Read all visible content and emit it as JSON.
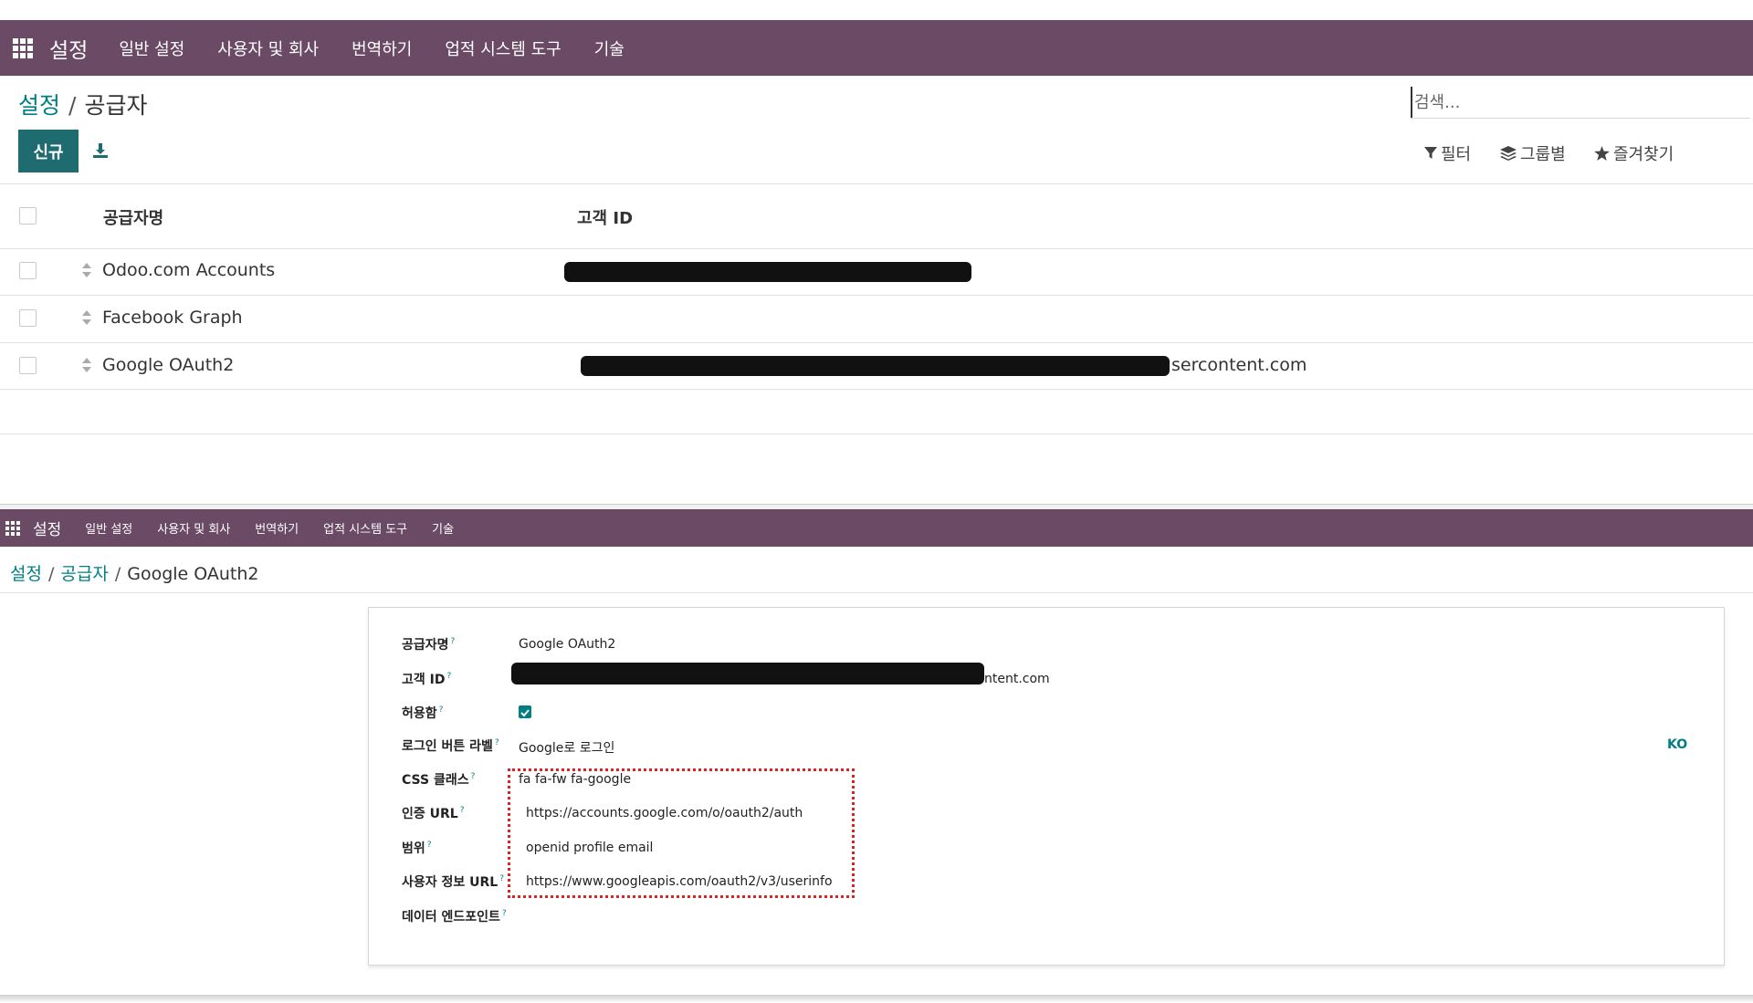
{
  "colors": {
    "navbar": "#6b4a66",
    "primary_button": "#1f6c70",
    "link": "#017e84",
    "highlight_border": "#dd2222"
  },
  "top": {
    "navbar": {
      "app_menu_icon": "grid-icon",
      "brand": "설정",
      "menu": [
        "일반 설정",
        "사용자 및 회사",
        "번역하기",
        "업적 시스템 도구",
        "기술"
      ]
    },
    "breadcrumb": {
      "parent": "설정",
      "separator": "/",
      "current": "공급자"
    },
    "search": {
      "placeholder": "검색..."
    },
    "buttons": {
      "new": "신규",
      "download_icon": "download-icon"
    },
    "search_options": {
      "filter": "필터",
      "group_by": "그룹별",
      "favorites": "즐겨찾기"
    },
    "table": {
      "columns": [
        "공급자명",
        "고객 ID"
      ],
      "rows": [
        {
          "name": "Odoo.com Accounts",
          "client_id": ""
        },
        {
          "name": "Facebook Graph",
          "client_id": ""
        },
        {
          "name": "Google OAuth2",
          "client_id": "sercontent.com"
        }
      ]
    }
  },
  "bottom": {
    "navbar": {
      "app_menu_icon": "grid-icon",
      "brand": "설정",
      "menu": [
        "일반 설정",
        "사용자 및 회사",
        "번역하기",
        "업적 시스템 도구",
        "기술"
      ]
    },
    "breadcrumb": {
      "root": "설정",
      "parent": "공급자",
      "separator": "/",
      "current": "Google OAuth2"
    },
    "form": {
      "fields": [
        {
          "label": "공급자명",
          "value": "Google OAuth2"
        },
        {
          "label": "고객 ID",
          "value": "ntent.com"
        },
        {
          "label": "허용함",
          "value": ""
        },
        {
          "label": "로그인 버튼 라벨",
          "value": "Google로 로그인"
        },
        {
          "label": "CSS 클래스",
          "value": "fa fa-fw fa-google"
        },
        {
          "label": "인증 URL",
          "value": "https://accounts.google.com/o/oauth2/auth"
        },
        {
          "label": "범위",
          "value": "openid profile email"
        },
        {
          "label": "사용자 정보 URL",
          "value": "https://www.googleapis.com/oauth2/v3/userinfo"
        },
        {
          "label": "데이터 엔드포인트",
          "value": ""
        }
      ],
      "help_marker": "?",
      "allowed_checked": true,
      "lang_button": "KO"
    }
  }
}
